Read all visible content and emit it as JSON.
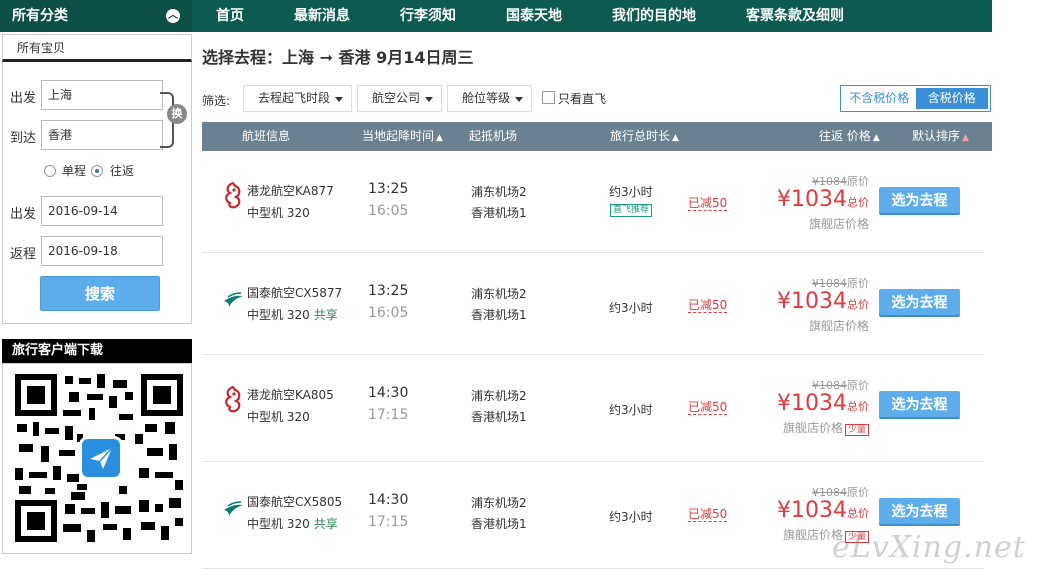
{
  "topbar": {
    "categories_label": "所有分类",
    "nav": [
      {
        "label": "首页"
      },
      {
        "label": "最新消息"
      },
      {
        "label": "行李须知"
      },
      {
        "label": "国泰天地"
      },
      {
        "label": "我们的目的地"
      },
      {
        "label": "客票条款及细则"
      }
    ]
  },
  "sidebar": {
    "tab_label": "所有宝贝",
    "from_label": "出发",
    "from_value": "上海",
    "to_label": "到达",
    "to_value": "香港",
    "swap_label": "换",
    "one_way_label": "单程",
    "round_trip_label": "往返",
    "depart_label": "出发",
    "depart_date": "2016-09-14",
    "return_label": "返程",
    "return_date": "2016-09-18",
    "search_label": "搜索",
    "app_title": "旅行客户端下载"
  },
  "main": {
    "title": "选择去程：上海 ➞ 香港  9月14日周三",
    "filter_label": "筛选:",
    "filters": [
      {
        "label": "去程起飞时段"
      },
      {
        "label": "航空公司"
      },
      {
        "label": "舱位等级"
      }
    ],
    "direct_only_label": "只看直飞",
    "price_toggle": {
      "excl_tax": "不含税价格",
      "incl_tax": "含税价格"
    },
    "columns": {
      "flight": "航班信息",
      "time": "当地起降时间",
      "airport": "起抵机场",
      "duration": "旅行总时长",
      "price": "往返 价格",
      "sort": "默认排序"
    },
    "flights": [
      {
        "airline": "港龙航空KA877",
        "aircraft": "中型机 320",
        "share": "",
        "dep_time": "13:25",
        "arr_time": "16:05",
        "dep_airport": "浦东机场2",
        "arr_airport": "香港机场1",
        "duration": "约3小时",
        "direct_tag": "直飞推荐",
        "discount": "已减50",
        "orig_price": "¥1084",
        "orig_label": "原价",
        "currency": "¥",
        "price": "1034",
        "price_unit": "总价",
        "store_label": "旗舰店价格",
        "few_label": "",
        "pick_label": "选为去程",
        "logo": "dragon-icon"
      },
      {
        "airline": "国泰航空CX5877",
        "aircraft": "中型机 320",
        "share": "共享",
        "dep_time": "13:25",
        "arr_time": "16:05",
        "dep_airport": "浦东机场2",
        "arr_airport": "香港机场1",
        "duration": "约3小时",
        "direct_tag": "",
        "discount": "已减50",
        "orig_price": "¥1084",
        "orig_label": "原价",
        "currency": "¥",
        "price": "1034",
        "price_unit": "总价",
        "store_label": "旗舰店价格",
        "few_label": "",
        "pick_label": "选为去程",
        "logo": "brushwing-icon"
      },
      {
        "airline": "港龙航空KA805",
        "aircraft": "中型机 320",
        "share": "",
        "dep_time": "14:30",
        "arr_time": "17:15",
        "dep_airport": "浦东机场2",
        "arr_airport": "香港机场1",
        "duration": "约3小时",
        "direct_tag": "",
        "discount": "已减50",
        "orig_price": "¥1084",
        "orig_label": "原价",
        "currency": "¥",
        "price": "1034",
        "price_unit": "总价",
        "store_label": "旗舰店价格",
        "few_label": "少量",
        "pick_label": "选为去程",
        "logo": "dragon-icon"
      },
      {
        "airline": "国泰航空CX5805",
        "aircraft": "中型机 320",
        "share": "共享",
        "dep_time": "14:30",
        "arr_time": "17:15",
        "dep_airport": "浦东机场2",
        "arr_airport": "香港机场1",
        "duration": "约3小时",
        "direct_tag": "",
        "discount": "已减50",
        "orig_price": "¥1084",
        "orig_label": "原价",
        "currency": "¥",
        "price": "1034",
        "price_unit": "总价",
        "store_label": "旗舰店价格",
        "few_label": "少量",
        "pick_label": "选为去程",
        "logo": "brushwing-icon"
      }
    ]
  },
  "watermark": "eLvXing.net",
  "colors": {
    "nav_bg": "#0d5b50",
    "header_row_bg": "#6a8191",
    "button_blue": "#5dadec",
    "price_red": "#e4393c"
  }
}
